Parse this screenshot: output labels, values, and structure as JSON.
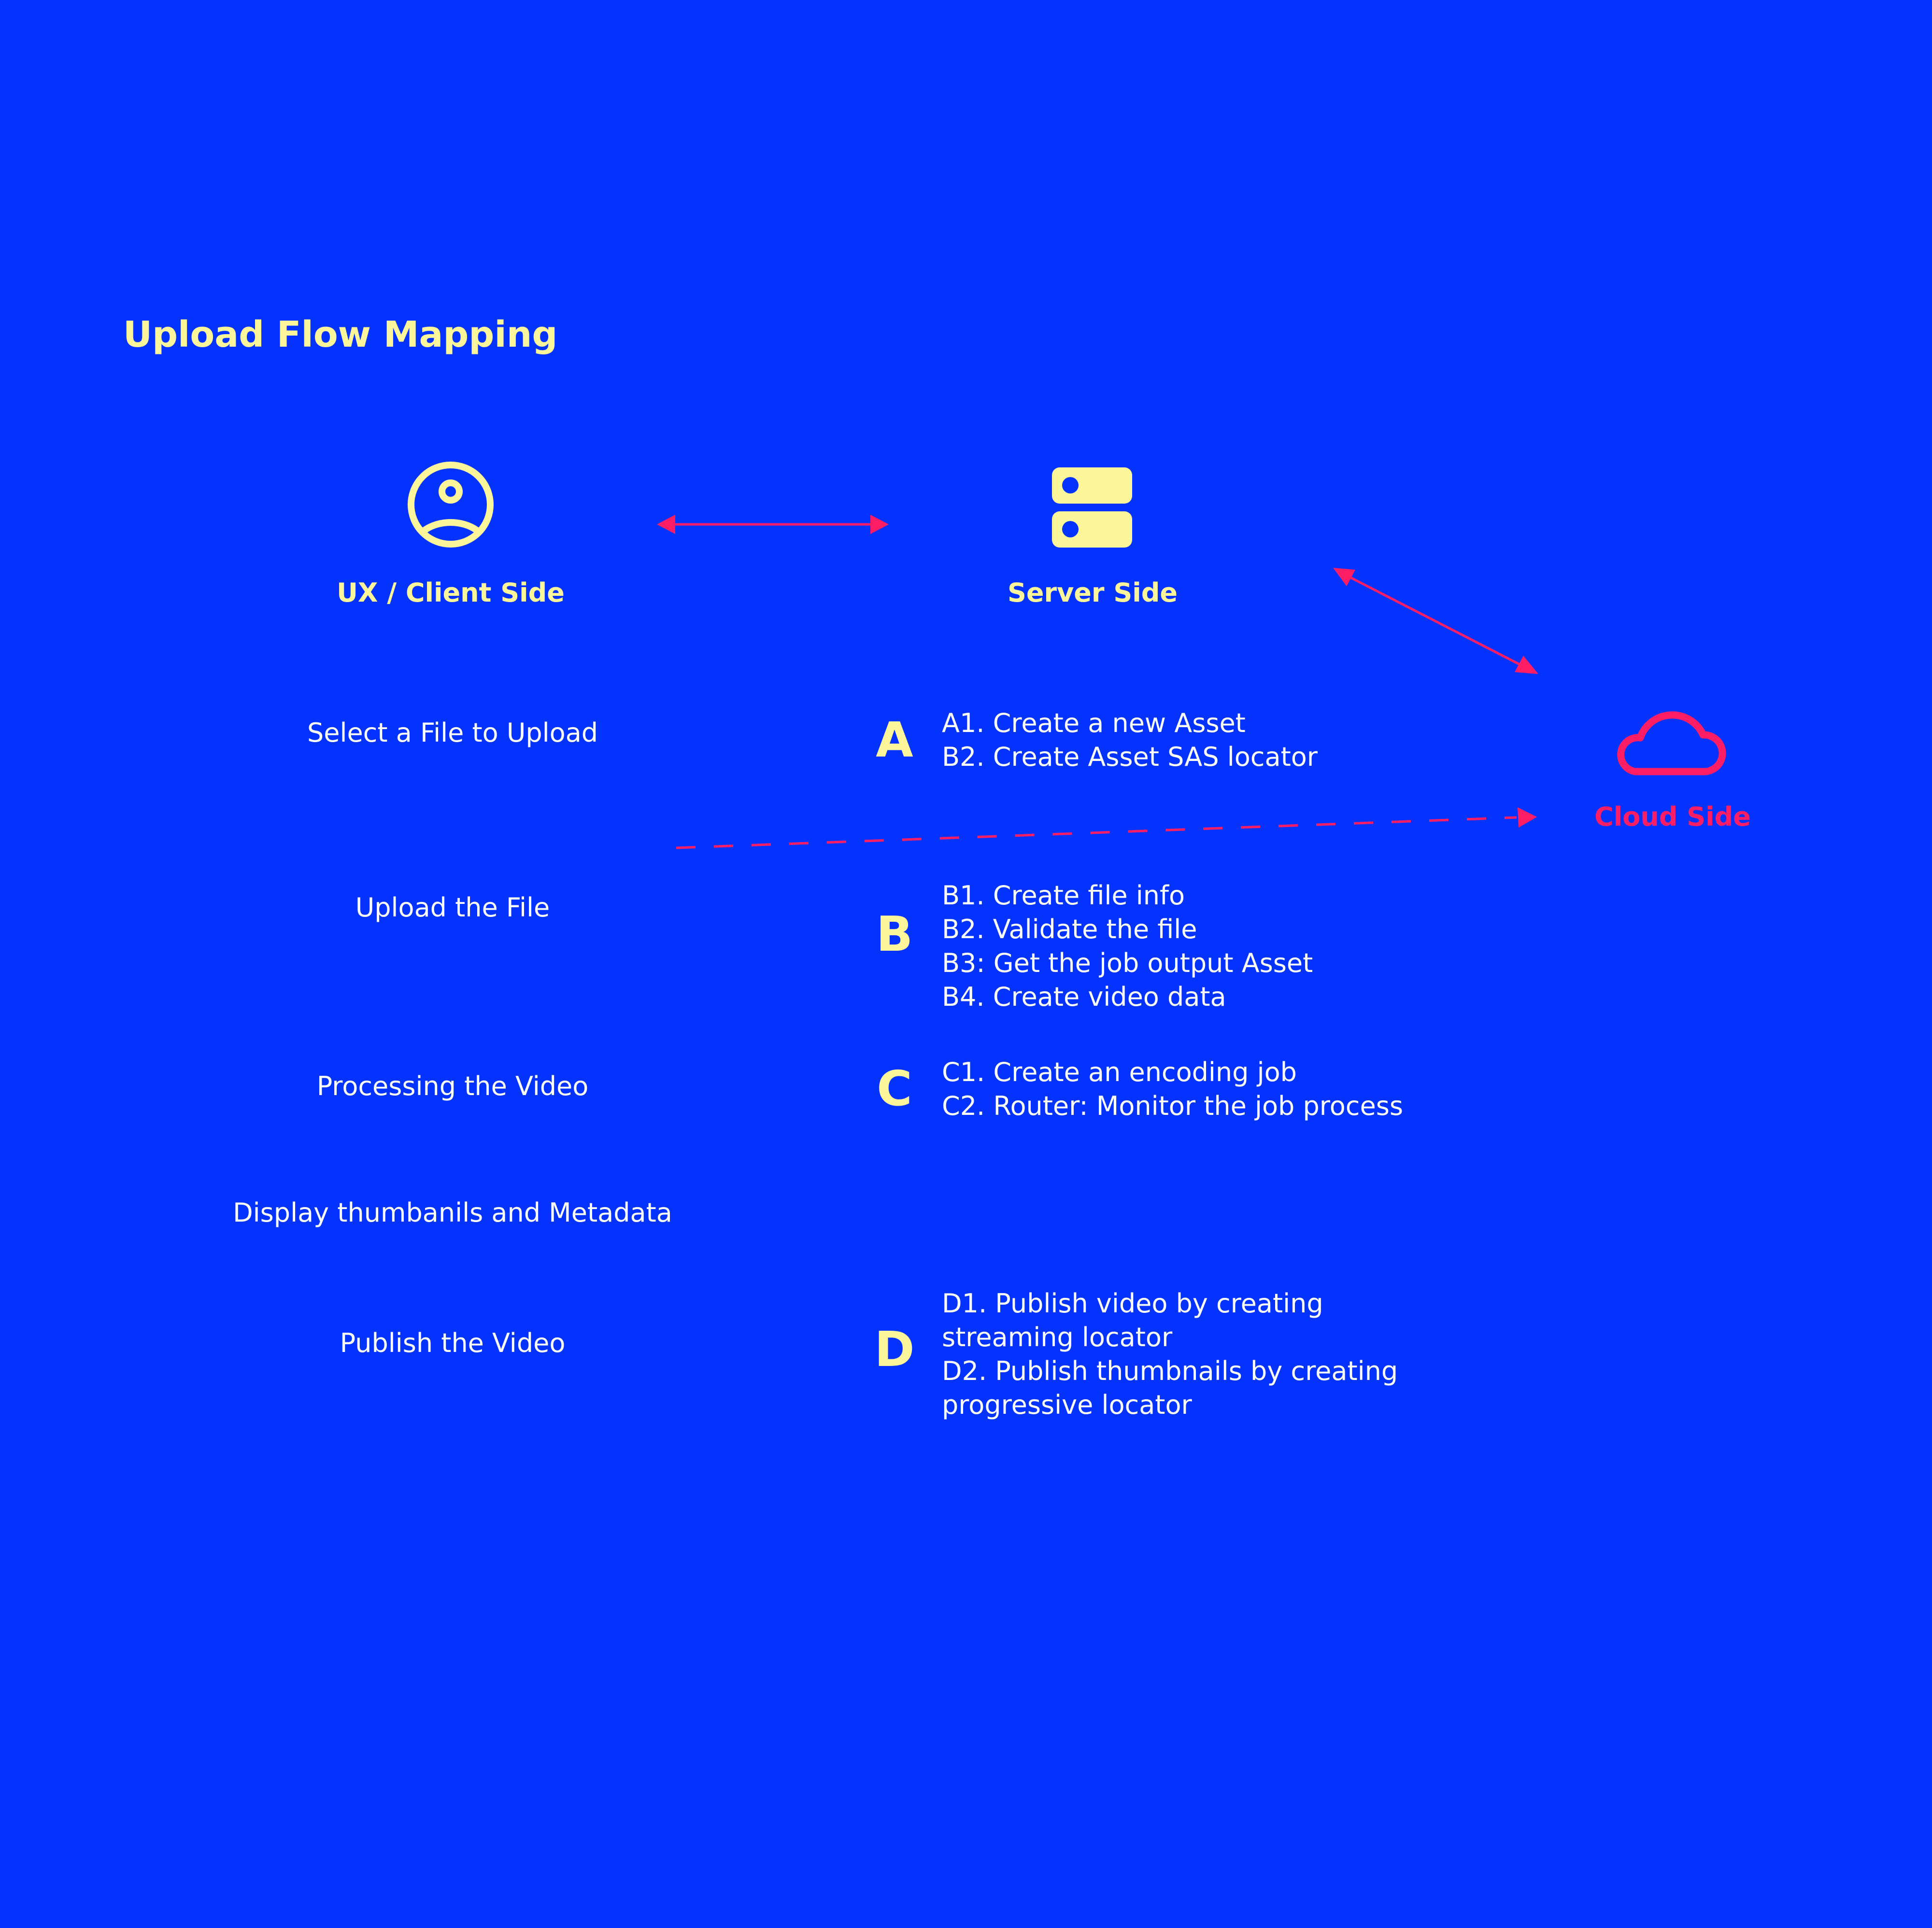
{
  "title": "Upload Flow Mapping",
  "columns": {
    "client": {
      "label": "UX / Client Side",
      "icon": "user-circle-icon"
    },
    "server": {
      "label": "Server Side",
      "icon": "server-icon"
    },
    "cloud": {
      "label": "Cloud Side",
      "icon": "cloud-icon"
    }
  },
  "client_steps": [
    "Select a File to Upload",
    "Upload the File",
    "Processing the Video",
    "Display thumbanils and Metadata",
    "Publish the Video"
  ],
  "server_blocks": [
    {
      "letter": "A",
      "lines": [
        "A1. Create a new Asset",
        "B2. Create Asset SAS locator"
      ]
    },
    {
      "letter": "B",
      "lines": [
        "B1. Create file info",
        "B2. Validate the file",
        "B3: Get the job output Asset",
        "B4. Create video data"
      ]
    },
    {
      "letter": "C",
      "lines": [
        "C1. Create an encoding job",
        "C2. Router: Monitor the job process"
      ]
    },
    {
      "letter": "D",
      "lines": [
        "D1. Publish video by creating",
        "streaming locator",
        "D2. Publish thumbnails by creating",
        "progressive locator"
      ]
    }
  ],
  "colors": {
    "background": "#0433FF",
    "accent_yellow": "#FDF59A",
    "accent_pink": "#FF1E66",
    "text": "#FFFFFF"
  }
}
